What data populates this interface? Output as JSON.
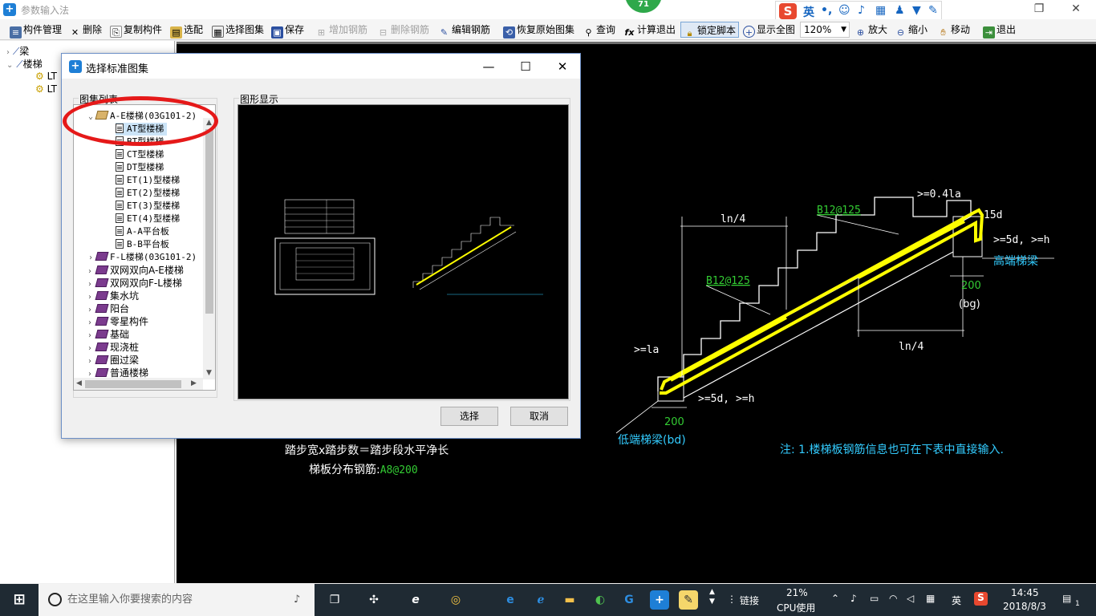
{
  "window": {
    "title": "参数输入法",
    "badge": "71"
  },
  "ime": {
    "logo": "S",
    "lang": "英",
    "punct": "•,"
  },
  "toolbar": {
    "items": [
      {
        "label": "构件管理",
        "icon": "component-manager-icon",
        "enabled": true
      },
      {
        "label": "删除",
        "icon": "delete-icon",
        "enabled": true
      },
      {
        "label": "复制构件",
        "icon": "copy-icon",
        "enabled": true
      },
      {
        "label": "选配",
        "icon": "select-match-icon",
        "enabled": true
      },
      {
        "label": "选择图集",
        "icon": "select-atlas-icon",
        "enabled": true
      },
      {
        "label": "保存",
        "icon": "save-icon",
        "enabled": true
      },
      {
        "label": "增加钢筋",
        "icon": "add-rebar-icon",
        "enabled": false
      },
      {
        "label": "删除钢筋",
        "icon": "delete-rebar-icon",
        "enabled": false
      },
      {
        "label": "编辑钢筋",
        "icon": "edit-rebar-icon",
        "enabled": true
      },
      {
        "label": "恢复原始图集",
        "icon": "restore-icon",
        "enabled": true
      },
      {
        "label": "查询",
        "icon": "binoculars-icon",
        "enabled": true
      },
      {
        "label": "计算退出",
        "icon": "fx-icon",
        "enabled": true
      },
      {
        "label": "锁定脚本",
        "icon": "lock-icon",
        "enabled": true,
        "pressed": true
      },
      {
        "label": "显示全图",
        "icon": "zoom-fit-icon",
        "enabled": true
      },
      {
        "label": "放大",
        "icon": "zoom-in-icon",
        "enabled": true
      },
      {
        "label": "缩小",
        "icon": "zoom-out-icon",
        "enabled": true
      },
      {
        "label": "移动",
        "icon": "move-icon",
        "enabled": true
      },
      {
        "label": "退出",
        "icon": "exit-icon",
        "enabled": true
      }
    ],
    "zoom": "120%"
  },
  "left_tree": {
    "items": [
      {
        "label": "梁"
      },
      {
        "label": "楼梯"
      },
      {
        "label": "LT"
      },
      {
        "label": "LT"
      }
    ]
  },
  "dialog": {
    "title": "选择标准图集",
    "list_caption": "图集列表",
    "preview_caption": "图形显示",
    "select_button": "选择",
    "cancel_button": "取消",
    "tree": [
      {
        "label": "A-E楼梯(03G101-2)",
        "kind": "group",
        "expanded": true
      },
      {
        "label": "AT型楼梯",
        "kind": "leaf",
        "selected": true
      },
      {
        "label": "BT型楼梯",
        "kind": "leaf"
      },
      {
        "label": "CT型楼梯",
        "kind": "leaf"
      },
      {
        "label": "DT型楼梯",
        "kind": "leaf"
      },
      {
        "label": "ET(1)型楼梯",
        "kind": "leaf"
      },
      {
        "label": "ET(2)型楼梯",
        "kind": "leaf"
      },
      {
        "label": "ET(3)型楼梯",
        "kind": "leaf"
      },
      {
        "label": "ET(4)型楼梯",
        "kind": "leaf"
      },
      {
        "label": "A-A平台板",
        "kind": "leaf"
      },
      {
        "label": "B-B平台板",
        "kind": "leaf"
      },
      {
        "label": "F-L楼梯(03G101-2)",
        "kind": "group"
      },
      {
        "label": "双网双向A-E楼梯",
        "kind": "group"
      },
      {
        "label": "双网双向F-L楼梯",
        "kind": "group"
      },
      {
        "label": "集水坑",
        "kind": "group"
      },
      {
        "label": "阳台",
        "kind": "group"
      },
      {
        "label": "零星构件",
        "kind": "group"
      },
      {
        "label": "基础",
        "kind": "group"
      },
      {
        "label": "现浇桩",
        "kind": "group"
      },
      {
        "label": "圈过梁",
        "kind": "group"
      },
      {
        "label": "普通楼梯",
        "kind": "group"
      }
    ]
  },
  "cad": {
    "top_bar_a": "B12@125",
    "top_bar_b": "B12@125",
    "ln4_top": "ln/4",
    "ln4_bottom": "ln/4",
    "dim_04la": ">=0.4la",
    "dim_15d": "15d",
    "dim_5d_h_top": ">=5d, >=h",
    "high_beam": "高端梯梁",
    "dim_200_right": "200",
    "bg": "(bg)",
    "dim_la": ">=la",
    "dim_5d_h_bottom": ">=5d, >=h",
    "dim_200_left": "200",
    "low_beam": "低端梯梁(bd)",
    "formula": "踏步宽x踏步数＝踏步段水平净长",
    "distribution_label": "梯板分布钢筋:",
    "distribution_value": "A8@200",
    "note": "注: 1.楼梯板钢筋信息也可在下表中直接输入."
  },
  "taskbar": {
    "search_placeholder": "在这里输入你要搜索的内容",
    "link_label": "链接",
    "cpu_value": "21%",
    "cpu_label": "CPU使用",
    "lang": "英",
    "time": "14:45",
    "date": "2018/8/3",
    "notif_count": "1"
  },
  "colors": {
    "accent": "#1e7fd6",
    "annotation": "#e51919",
    "cad_yellow": "#ffff00",
    "cad_green": "#33cc33",
    "cad_cyan": "#33ccff"
  }
}
